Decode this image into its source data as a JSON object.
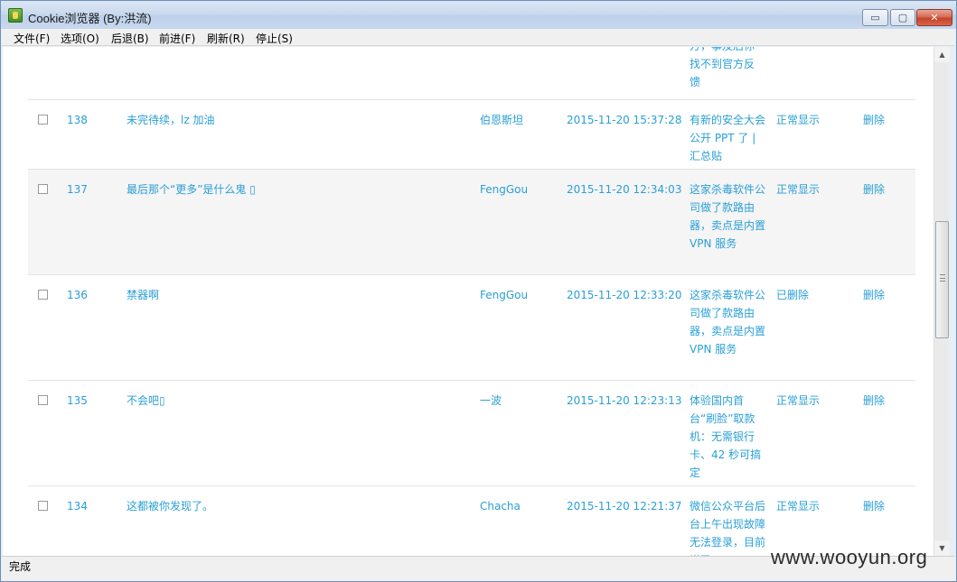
{
  "window": {
    "title": "Cookie浏览器 (By:洪流)",
    "minimize_glyph": "▭",
    "maximize_glyph": "▢",
    "close_glyph": "✕",
    "icon": "app-icon"
  },
  "menu": {
    "items": [
      "文件(F)",
      "选项(O)",
      "后退(B)",
      "前进(F)",
      "刷新(R)",
      "停止(S)"
    ]
  },
  "colors": {
    "link": "#2a9fd6",
    "row_alt": "#f5f5f5"
  },
  "partial_row": {
    "topic_lines": [
      "方，事及后你",
      "找不到官方反",
      "馈"
    ]
  },
  "rows": [
    {
      "id": "138",
      "title": "未完待续，lz 加油",
      "user": "伯恩斯坦",
      "time": "2015-11-20 15:37:28",
      "topic": "有新的安全大会公开 PPT 了 | 汇总贴",
      "status": "正常显示",
      "action": "删除"
    },
    {
      "id": "137",
      "title": "最后那个“更多”是什么鬼 ▯",
      "user": "FengGou",
      "time": "2015-11-20 12:34:03",
      "topic": "这家杀毒软件公司做了款路由器，卖点是内置 VPN 服务",
      "status": "正常显示",
      "action": "删除"
    },
    {
      "id": "136",
      "title": "禁器啊",
      "user": "FengGou",
      "time": "2015-11-20 12:33:20",
      "topic": "这家杀毒软件公司做了款路由器，卖点是内置 VPN 服务",
      "status": "已删除",
      "action": "删除"
    },
    {
      "id": "135",
      "title": "不会吧▯",
      "user": "一波",
      "time": "2015-11-20 12:23:13",
      "topic": "体验国内首台“刷脸”取款机：无需银行卡、42 秒可搞定",
      "status": "正常显示",
      "action": "删除"
    },
    {
      "id": "134",
      "title": "这都被你发现了。",
      "user": "Chacha",
      "time": "2015-11-20 12:21:37",
      "topic": "微信公众平台后台上午出现故障无法登录，目前尚已",
      "status": "正常显示",
      "action": "删除"
    }
  ],
  "status": {
    "text": "完成",
    "watermark": "www.wooyun.org"
  }
}
